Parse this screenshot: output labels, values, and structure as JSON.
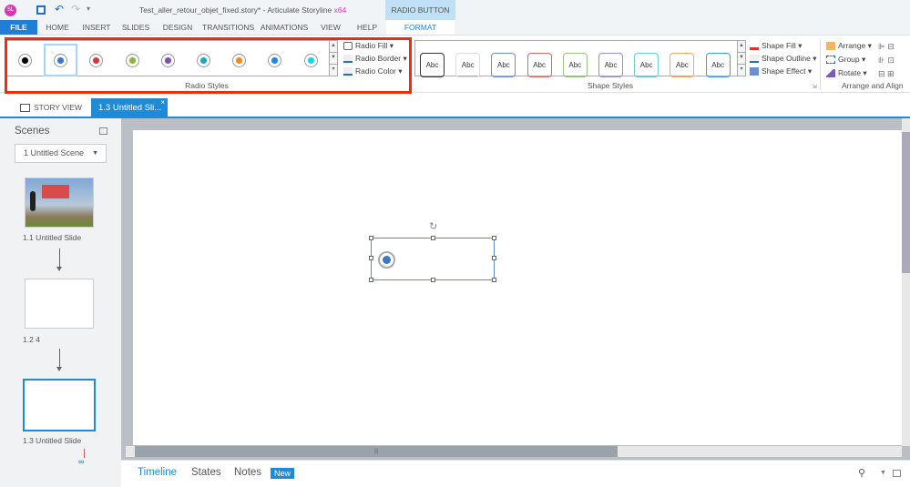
{
  "title": {
    "file": "Test_aller_retour_objet_fixed.story*",
    "sep": " - ",
    "app": "Articulate Storyline",
    "arch": "x64",
    "app_icon": "SL"
  },
  "context_tab": "RADIO BUTTON",
  "tabs": [
    "FILE",
    "HOME",
    "INSERT",
    "SLIDES",
    "DESIGN",
    "TRANSITIONS",
    "ANIMATIONS",
    "VIEW",
    "HELP",
    "FORMAT"
  ],
  "radio_styles": {
    "label": "Radio Styles",
    "colors": [
      "#000000",
      "#3a78c9",
      "#d03a3a",
      "#86b63c",
      "#7d52a8",
      "#1aa9c0",
      "#f48a1a",
      "#1c86e8",
      "#13d6ea"
    ],
    "fill": "Radio Fill",
    "border": "Radio Border",
    "color": "Radio Color"
  },
  "shape_styles": {
    "label": "Shape Styles",
    "sample": "Abc",
    "borders": [
      "#333333",
      "#dddddd",
      "#6b8fc9",
      "#e06666",
      "#9bc27a",
      "#a58bc6",
      "#6bcbdb",
      "#f5a86a",
      "#3a9af0"
    ],
    "fill": "Shape Fill",
    "outline": "Shape Outline",
    "effect": "Shape Effect"
  },
  "arrange": {
    "label": "Arrange and Align",
    "arrange": "Arrange",
    "group": "Group",
    "rotate": "Rotate"
  },
  "doc_tabs": {
    "story_view": "STORY VIEW",
    "slide": "1.3 Untitled Sli..."
  },
  "scenes": {
    "title": "Scenes",
    "dropdown": "1 Untitled Scene",
    "slides": [
      "1.1 Untitled Slide",
      "1.2 4",
      "1.3 Untitled Slide"
    ]
  },
  "bottom": {
    "timeline": "Timeline",
    "states": "States",
    "notes": "Notes",
    "new": "New"
  }
}
